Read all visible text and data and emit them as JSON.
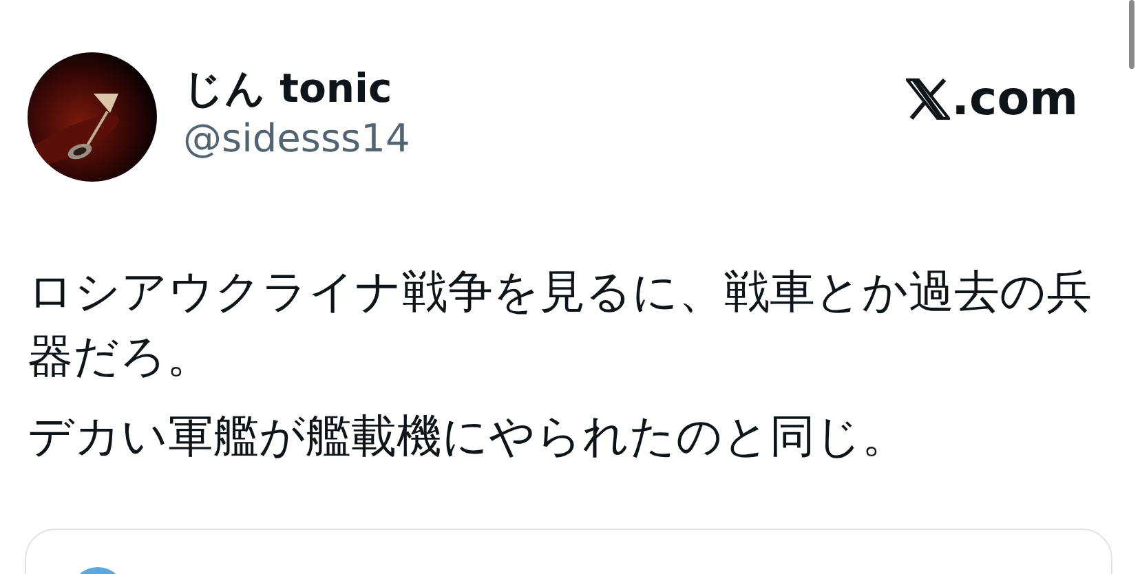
{
  "author": {
    "name": "じん tonic",
    "handle": "@sidesss14"
  },
  "site": {
    "label": ".com"
  },
  "body": [
    "ロシアウクライナ戦争を見るに、戦車とか過去の兵器だろ。",
    "デカい軍艦が艦載機にやられたのと同じ。"
  ]
}
